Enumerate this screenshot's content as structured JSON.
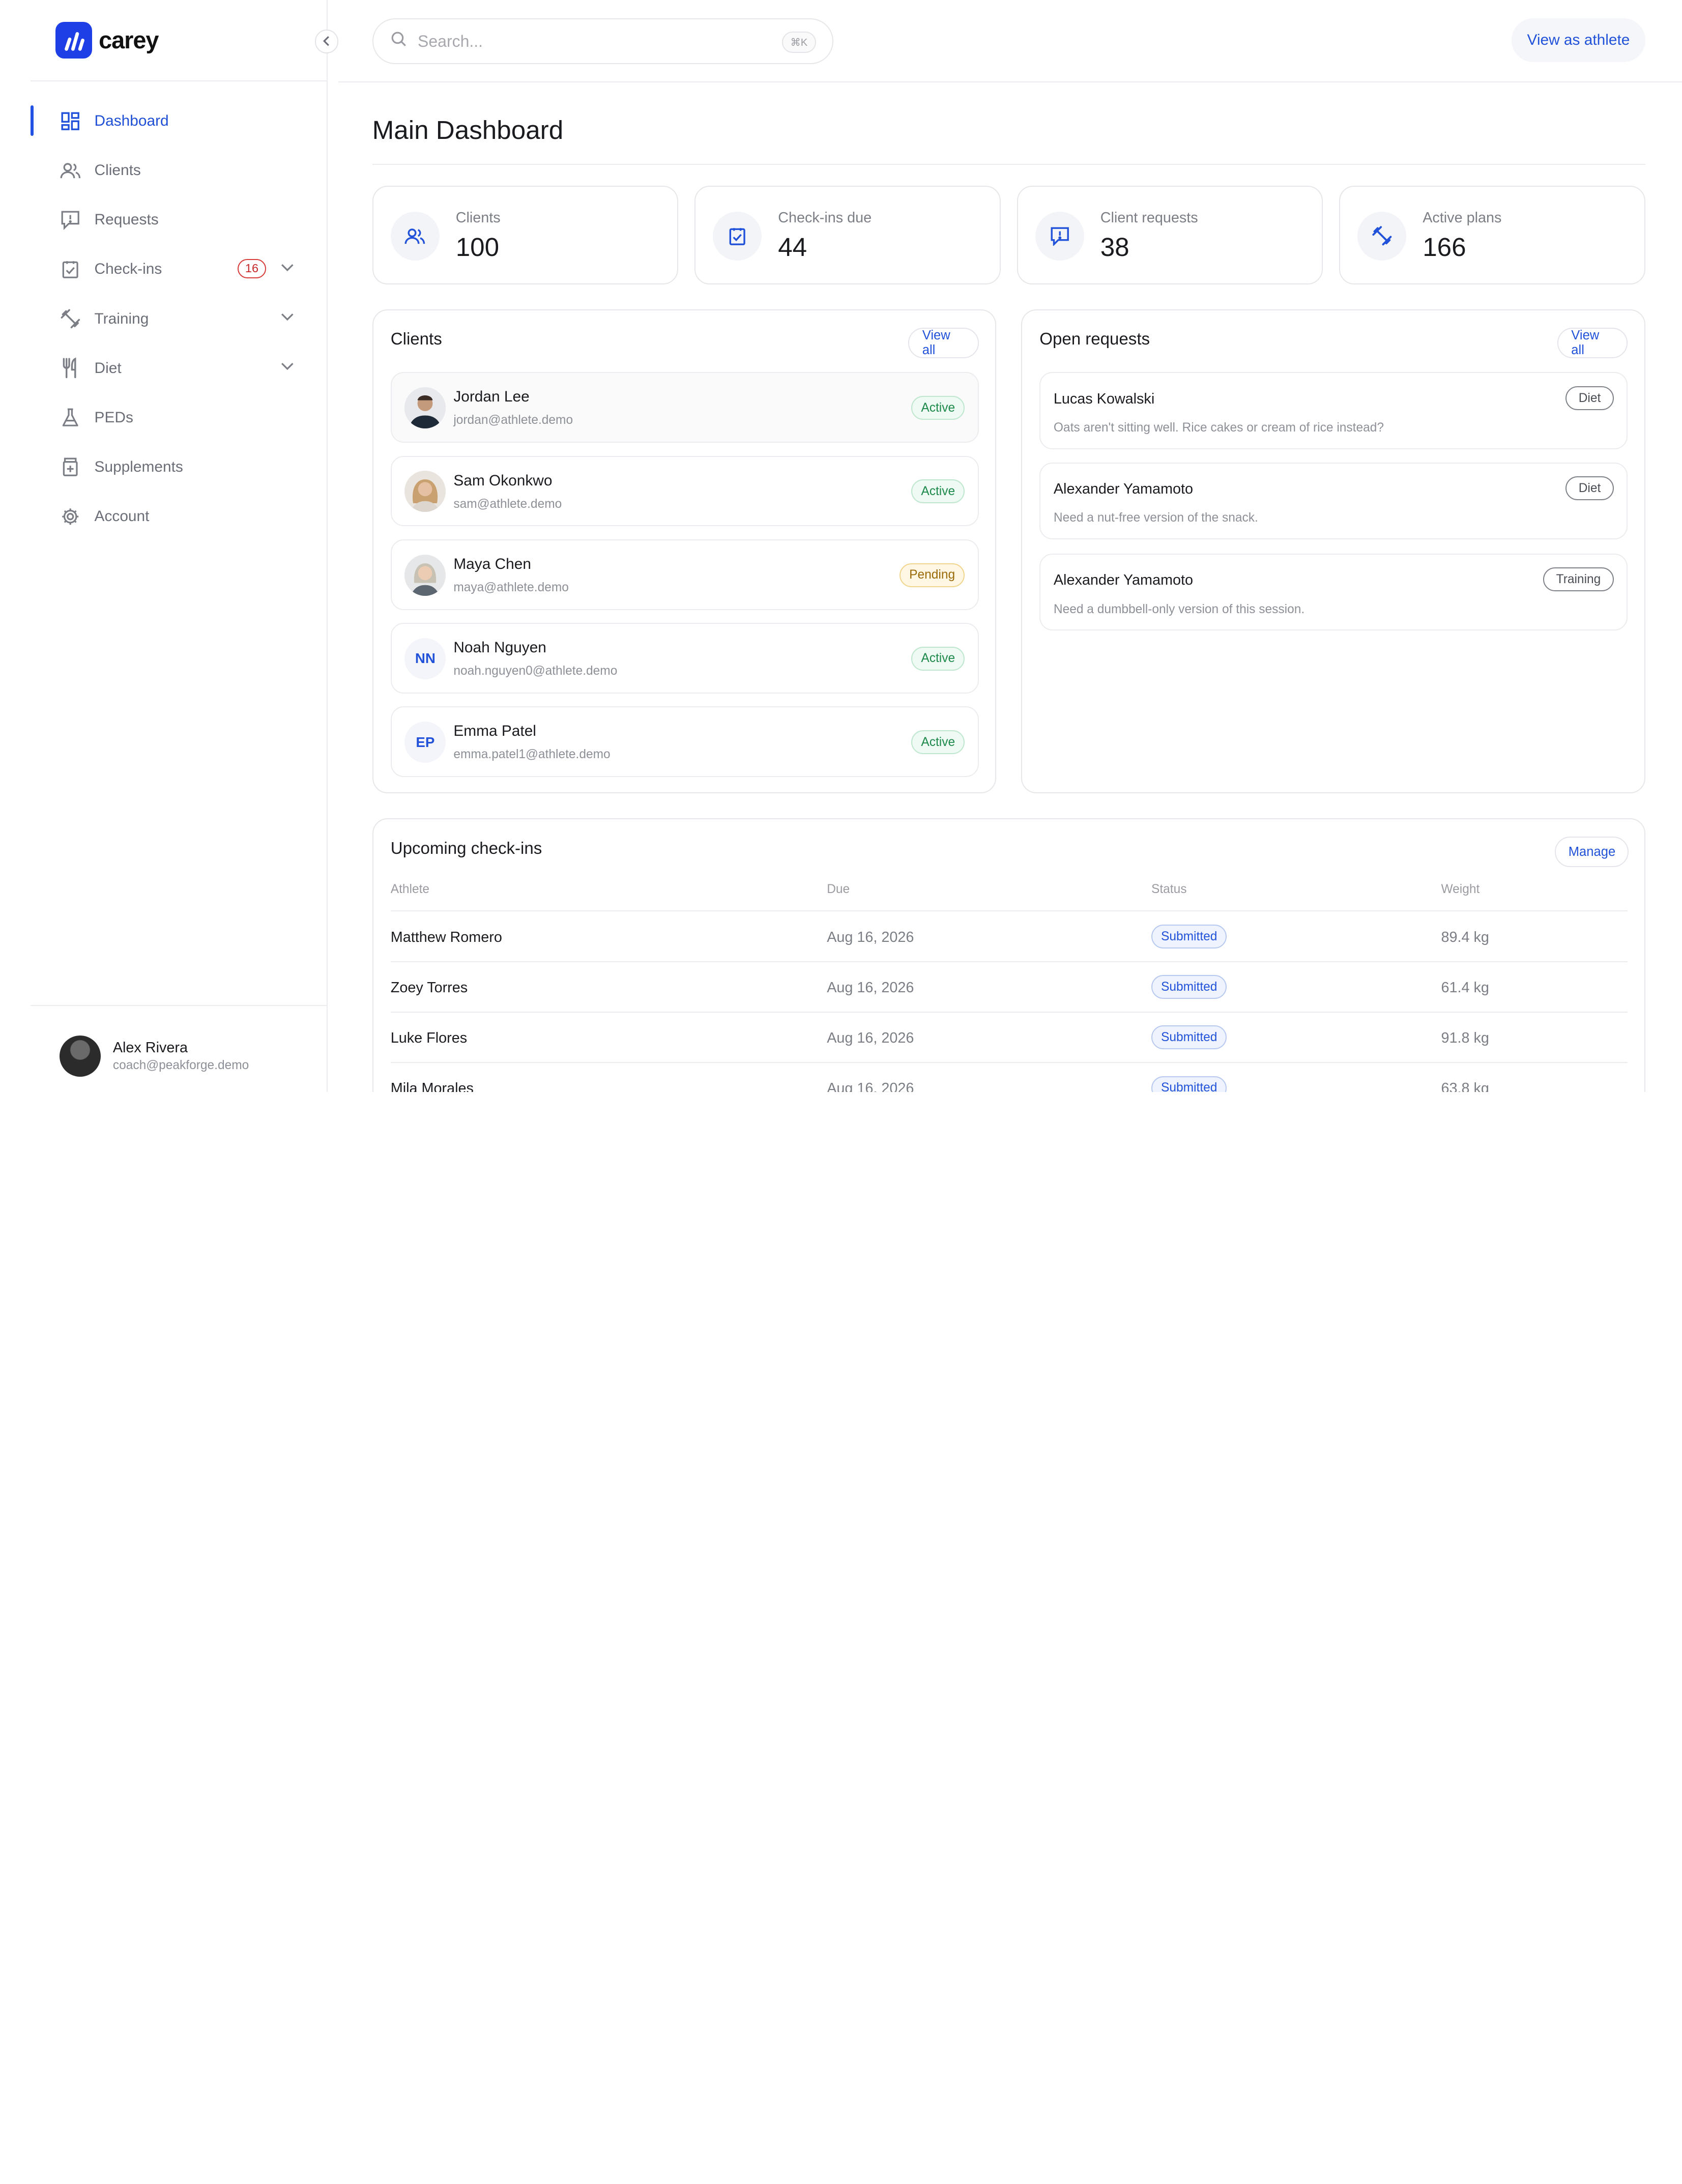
{
  "brand": {
    "name": "carey"
  },
  "sidebar": {
    "items": [
      {
        "label": "Dashboard",
        "icon": "dashboard-icon",
        "active": true
      },
      {
        "label": "Clients",
        "icon": "users-icon"
      },
      {
        "label": "Requests",
        "icon": "message-alert-icon"
      },
      {
        "label": "Check-ins",
        "icon": "clipboard-check-icon",
        "badge": "16",
        "expandable": true
      },
      {
        "label": "Training",
        "icon": "dumbbell-icon",
        "expandable": true
      },
      {
        "label": "Diet",
        "icon": "utensils-icon",
        "expandable": true
      },
      {
        "label": "PEDs",
        "icon": "flask-icon"
      },
      {
        "label": "Supplements",
        "icon": "pill-bottle-icon"
      },
      {
        "label": "Account",
        "icon": "gear-icon"
      }
    ],
    "user": {
      "name": "Alex Rivera",
      "email": "coach@peakforge.demo"
    }
  },
  "topbar": {
    "search_placeholder": "Search...",
    "shortcut": "⌘K",
    "view_as_athlete": "View as athlete"
  },
  "page": {
    "title": "Main Dashboard"
  },
  "stats": [
    {
      "label": "Clients",
      "value": "100",
      "icon": "users-icon"
    },
    {
      "label": "Check-ins due",
      "value": "44",
      "icon": "clipboard-check-icon"
    },
    {
      "label": "Client requests",
      "value": "38",
      "icon": "message-alert-icon"
    },
    {
      "label": "Active plans",
      "value": "166",
      "icon": "dumbbell-icon"
    }
  ],
  "clients_panel": {
    "title": "Clients",
    "view_all": "View all",
    "rows": [
      {
        "name": "Jordan Lee",
        "email": "jordan@athlete.demo",
        "status": "Active",
        "avatar": "photo"
      },
      {
        "name": "Sam Okonkwo",
        "email": "sam@athlete.demo",
        "status": "Active",
        "avatar": "photo"
      },
      {
        "name": "Maya Chen",
        "email": "maya@athlete.demo",
        "status": "Pending",
        "avatar": "photo"
      },
      {
        "name": "Noah Nguyen",
        "email": "noah.nguyen0@athlete.demo",
        "status": "Active",
        "initials": "NN"
      },
      {
        "name": "Emma Patel",
        "email": "emma.patel1@athlete.demo",
        "status": "Active",
        "initials": "EP"
      }
    ]
  },
  "requests_panel": {
    "title": "Open requests",
    "view_all": "View all",
    "rows": [
      {
        "name": "Lucas Kowalski",
        "text": "Oats aren't sitting well. Rice cakes or cream of rice instead?",
        "tag": "Diet"
      },
      {
        "name": "Alexander Yamamoto",
        "text": "Need a nut-free version of the snack.",
        "tag": "Diet"
      },
      {
        "name": "Alexander Yamamoto",
        "text": "Need a dumbbell-only version of this session.",
        "tag": "Training"
      }
    ]
  },
  "checkins": {
    "title": "Upcoming check-ins",
    "manage": "Manage",
    "columns": [
      "Athlete",
      "Due",
      "Status",
      "Weight"
    ],
    "rows": [
      {
        "athlete": "Matthew Romero",
        "due": "Aug 16, 2026",
        "status": "Submitted",
        "weight": "89.4 kg"
      },
      {
        "athlete": "Zoey Torres",
        "due": "Aug 16, 2026",
        "status": "Submitted",
        "weight": "61.4 kg"
      },
      {
        "athlete": "Luke Flores",
        "due": "Aug 16, 2026",
        "status": "Submitted",
        "weight": "91.8 kg"
      },
      {
        "athlete": "Mila Morales",
        "due": "Aug 16, 2026",
        "status": "Submitted",
        "weight": "63.8 kg"
      }
    ]
  },
  "colors": {
    "accent": "#2152d9",
    "brand": "#1f3fe6",
    "active_green": "#1d8a4c",
    "pending_amber": "#9a6a09",
    "badge_red": "#c62828"
  }
}
